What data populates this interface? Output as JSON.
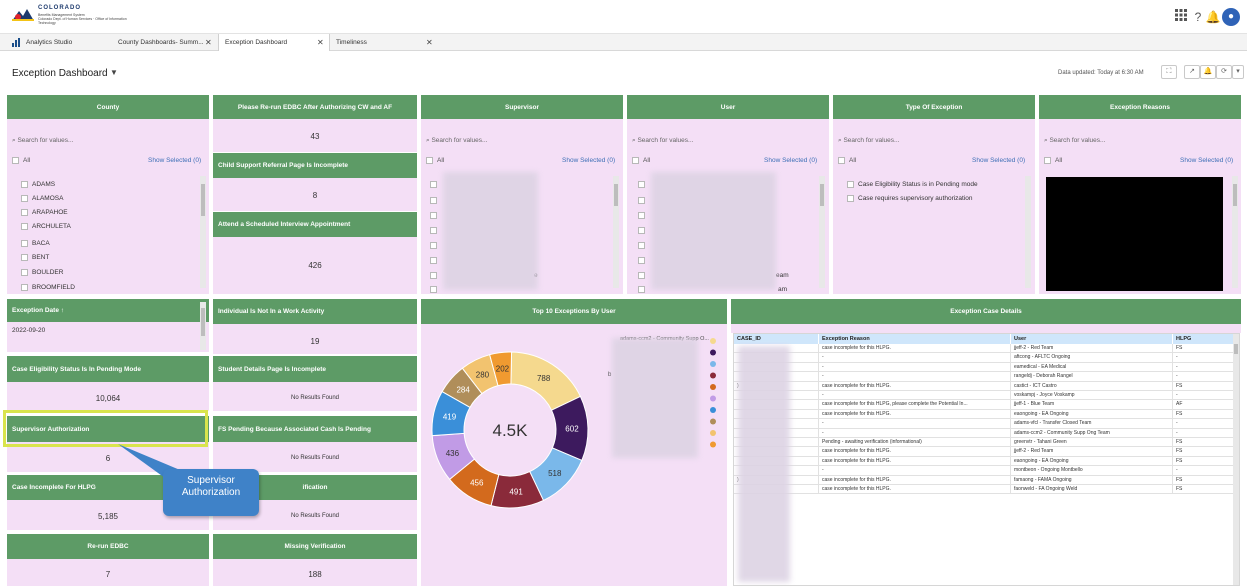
{
  "app": {
    "logo_title": "COLORADO",
    "logo_subtitle": "Benefits Management System",
    "logo_small": "Colorado Dept. of Human Services · Office of Information Technology"
  },
  "tabs": [
    {
      "label": "Analytics Studio"
    },
    {
      "label": "County Dashboards- Summ...",
      "close": "✕"
    },
    {
      "label": "Exception Dashboard",
      "close": "✕"
    },
    {
      "label": "Timeliness",
      "close": "✕"
    }
  ],
  "header": {
    "title": "Exception Dashboard",
    "caret": "▼",
    "updated": "Data updated: Today at 6:30 AM"
  },
  "filters": {
    "county": {
      "title": "County",
      "search_placeholder": "Search for values...",
      "all": "All",
      "show_selected": "Show Selected (0)",
      "items": [
        "ADAMS",
        "ALAMOSA",
        "ARAPAHOE",
        "ARCHULETA",
        "BACA",
        "BENT",
        "BOULDER",
        "BROOMFIELD"
      ]
    },
    "supervisor": {
      "title": "Supervisor",
      "search_placeholder": "Search for values...",
      "all": "All",
      "show_selected": "Show Selected (0)"
    },
    "user": {
      "title": "User",
      "search_placeholder": "Search for values...",
      "all": "All",
      "show_selected": "Show Selected (0)"
    },
    "type": {
      "title": "Type Of Exception",
      "search_placeholder": "Search for values...",
      "all": "All",
      "show_selected": "Show Selected (0)",
      "items": [
        "Case Eligibility Status is in Pending mode",
        "Case requires supervisory authorization"
      ]
    },
    "reasons": {
      "title": "Exception Reasons",
      "search_placeholder": "Search for values...",
      "all": "All",
      "show_selected": "Show Selected (0)"
    },
    "date": {
      "title": "Exception Date",
      "arrow": "↑",
      "value": "2022-09-20"
    }
  },
  "metrics": {
    "rerun_auth": {
      "title": "Please Re-run EDBC After Authorizing CW and AF",
      "value": "43"
    },
    "child_support": {
      "title": "Child Support Referral Page Is Incomplete",
      "value": "8"
    },
    "interview": {
      "title": "Attend a Scheduled Interview Appointment",
      "value": "426"
    },
    "work_activity": {
      "title": "Individual Is Not In a Work Activity",
      "value": "19"
    },
    "student": {
      "title": "Student Details Page Is Incomplete",
      "value": "No Results Found"
    },
    "fs_pending": {
      "title": "FS Pending Because Associated Cash Is Pending",
      "value": "No Results Found"
    },
    "verification_partial": {
      "title": "ification",
      "value": "No Results Found"
    },
    "missing_verification": {
      "title": "Missing Verification",
      "value": "188"
    },
    "eligibility_pending": {
      "title": "Case Eligibility Status Is In Pending Mode",
      "value": "10,064"
    },
    "supervisor_auth": {
      "title": "Supervisor Authorization",
      "value": "6"
    },
    "incomplete_hlpg": {
      "title": "Case Incomplete For HLPG",
      "value": "5,185"
    },
    "rerun_edbc": {
      "title": "Re-run EDBC",
      "value": "7"
    },
    "hidden_value": "No Results Found"
  },
  "top10": {
    "title": "Top 10 Exceptions By User",
    "center": "4.5K",
    "legend_label": "adams-ccm2 - Community Supp O...",
    "legend_b": "b"
  },
  "chart_data": {
    "type": "pie",
    "title": "Top 10 Exceptions By User",
    "total_label": "4.5K",
    "values": [
      788,
      602,
      518,
      491,
      456,
      436,
      419,
      284,
      280,
      202
    ],
    "colors": [
      "#f5d98e",
      "#3d1a5e",
      "#7ab8ea",
      "#8a2a3a",
      "#d36a1d",
      "#c19be6",
      "#3a8fd9",
      "#b08e5a",
      "#f2c36f",
      "#f09a30"
    ]
  },
  "table": {
    "title": "Exception Case Details",
    "columns": [
      "CASE_ID",
      "Exception Reason",
      "User",
      "HLPG"
    ],
    "rows": [
      [
        "",
        "case incomplete for this HLPG.",
        "jjeff-2 - Red Team",
        "FS"
      ],
      [
        "",
        "-",
        "aftcong - AFLTC Ongoing",
        "-"
      ],
      [
        "",
        "-",
        "eamedical - EA Medical",
        "-"
      ],
      [
        "",
        "-",
        "rangeldj - Deborah Rangel",
        "-"
      ],
      [
        ")",
        "case incomplete for this HLPG.",
        "castict - ICT Castro",
        "FS"
      ],
      [
        "",
        "-",
        "voskampj - Joyce Voskamp",
        "-"
      ],
      [
        "",
        "case incomplete for this HLPG, please complete the Potential In...",
        "jjeff-1 - Blue Team",
        "AF"
      ],
      [
        "",
        "case incomplete for this HLPG.",
        "eaongoing - EA Ongoing",
        "FS"
      ],
      [
        "",
        "-",
        "adams-vfcl - Transfer Closed Team",
        "-"
      ],
      [
        "",
        "-",
        "adams-ccm2 - Community Supp Ong Team",
        "-"
      ],
      [
        "",
        "Pending - awaiting verification (informational)",
        "greenvtr - Tahani Green",
        "FS"
      ],
      [
        "",
        "case incomplete for this HLPG.",
        "jjeff-2 - Red Team",
        "FS"
      ],
      [
        "",
        "case incomplete for this HLPG.",
        "eaongoing - EA Ongoing",
        "FS"
      ],
      [
        "",
        "-",
        "montbeon - Ongoing Montbello",
        "-"
      ],
      [
        ")",
        "case incomplete for this HLPG.",
        "famaong - FAMA Ongoing",
        "FS"
      ],
      [
        "",
        "case incomplete for this HLPG.",
        "faonweld - FA Ongoing Weld",
        "FS"
      ]
    ]
  },
  "callout": {
    "text": "Supervisor Authorization"
  },
  "user_list_fragments": {
    "eam1": "eam",
    "eam2": "am",
    "e": "e"
  }
}
